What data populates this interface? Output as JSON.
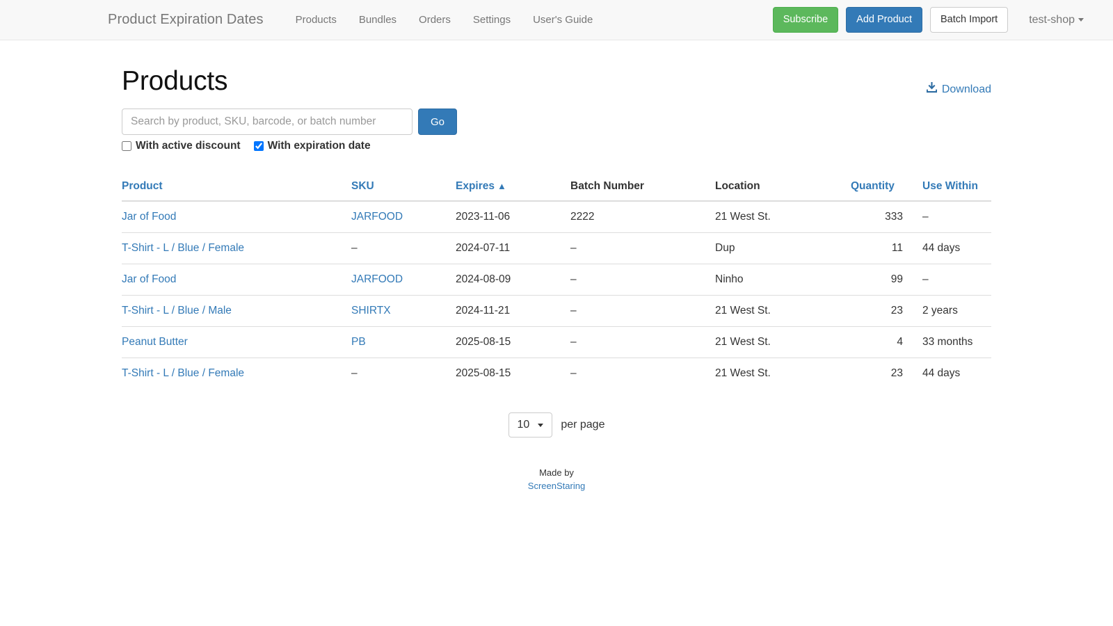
{
  "navbar": {
    "brand": "Product Expiration Dates",
    "links": [
      {
        "label": "Products"
      },
      {
        "label": "Bundles"
      },
      {
        "label": "Orders"
      },
      {
        "label": "Settings"
      },
      {
        "label": "User's Guide"
      }
    ],
    "subscribe_label": "Subscribe",
    "add_product_label": "Add Product",
    "batch_import_label": "Batch Import",
    "shop_name": "test-shop",
    "colors": {
      "subscribe": "#5cb85c",
      "add_product": "#337ab7",
      "batch_import": "#ffffff",
      "navbar_bg": "#f8f8f8",
      "nav_text": "#777777"
    }
  },
  "page": {
    "title": "Products",
    "download_label": "Download",
    "accent_color": "#337ab7"
  },
  "search": {
    "placeholder": "Search by product, SKU, barcode, or batch number",
    "value": "",
    "go_label": "Go"
  },
  "filters": [
    {
      "label": "With active discount",
      "checked": false
    },
    {
      "label": "With expiration date",
      "checked": true
    }
  ],
  "table": {
    "headers": [
      {
        "label": "Product",
        "link": true,
        "sorted": false
      },
      {
        "label": "SKU",
        "link": true,
        "sorted": false
      },
      {
        "label": "Expires",
        "link": true,
        "sorted": true,
        "sort_arrow": "▲"
      },
      {
        "label": "Batch Number",
        "link": false,
        "sorted": false
      },
      {
        "label": "Location",
        "link": false,
        "sorted": false
      },
      {
        "label": "Quantity",
        "link": true,
        "sorted": false
      },
      {
        "label": "Use Within",
        "link": true,
        "sorted": false
      }
    ],
    "rows": [
      {
        "product": "Jar of Food",
        "sku": "JARFOOD",
        "sku_link": true,
        "expires": "2023-11-06",
        "batch_number": "2222",
        "location": "21 West St.",
        "quantity": "333",
        "use_within": "–"
      },
      {
        "product": "T-Shirt - L / Blue / Female",
        "sku": "–",
        "sku_link": false,
        "expires": "2024-07-11",
        "batch_number": "–",
        "location": "Dup",
        "quantity": "11",
        "use_within": "44 days"
      },
      {
        "product": "Jar of Food",
        "sku": "JARFOOD",
        "sku_link": true,
        "expires": "2024-08-09",
        "batch_number": "–",
        "location": "Ninho",
        "quantity": "99",
        "use_within": "–"
      },
      {
        "product": "T-Shirt - L / Blue / Male",
        "sku": "SHIRTX",
        "sku_link": true,
        "expires": "2024-11-21",
        "batch_number": "–",
        "location": "21 West St.",
        "quantity": "23",
        "use_within": "2 years"
      },
      {
        "product": "Peanut Butter",
        "sku": "PB",
        "sku_link": true,
        "expires": "2025-08-15",
        "batch_number": "–",
        "location": "21 West St.",
        "quantity": "4",
        "use_within": "33 months"
      },
      {
        "product": "T-Shirt - L / Blue / Female",
        "sku": "–",
        "sku_link": false,
        "expires": "2025-08-15",
        "batch_number": "–",
        "location": "21 West St.",
        "quantity": "23",
        "use_within": "44 days"
      }
    ]
  },
  "pagination": {
    "per_page_value": "10",
    "per_page_label": "per page"
  },
  "footer": {
    "made_by": "Made by",
    "author": "ScreenStaring"
  }
}
